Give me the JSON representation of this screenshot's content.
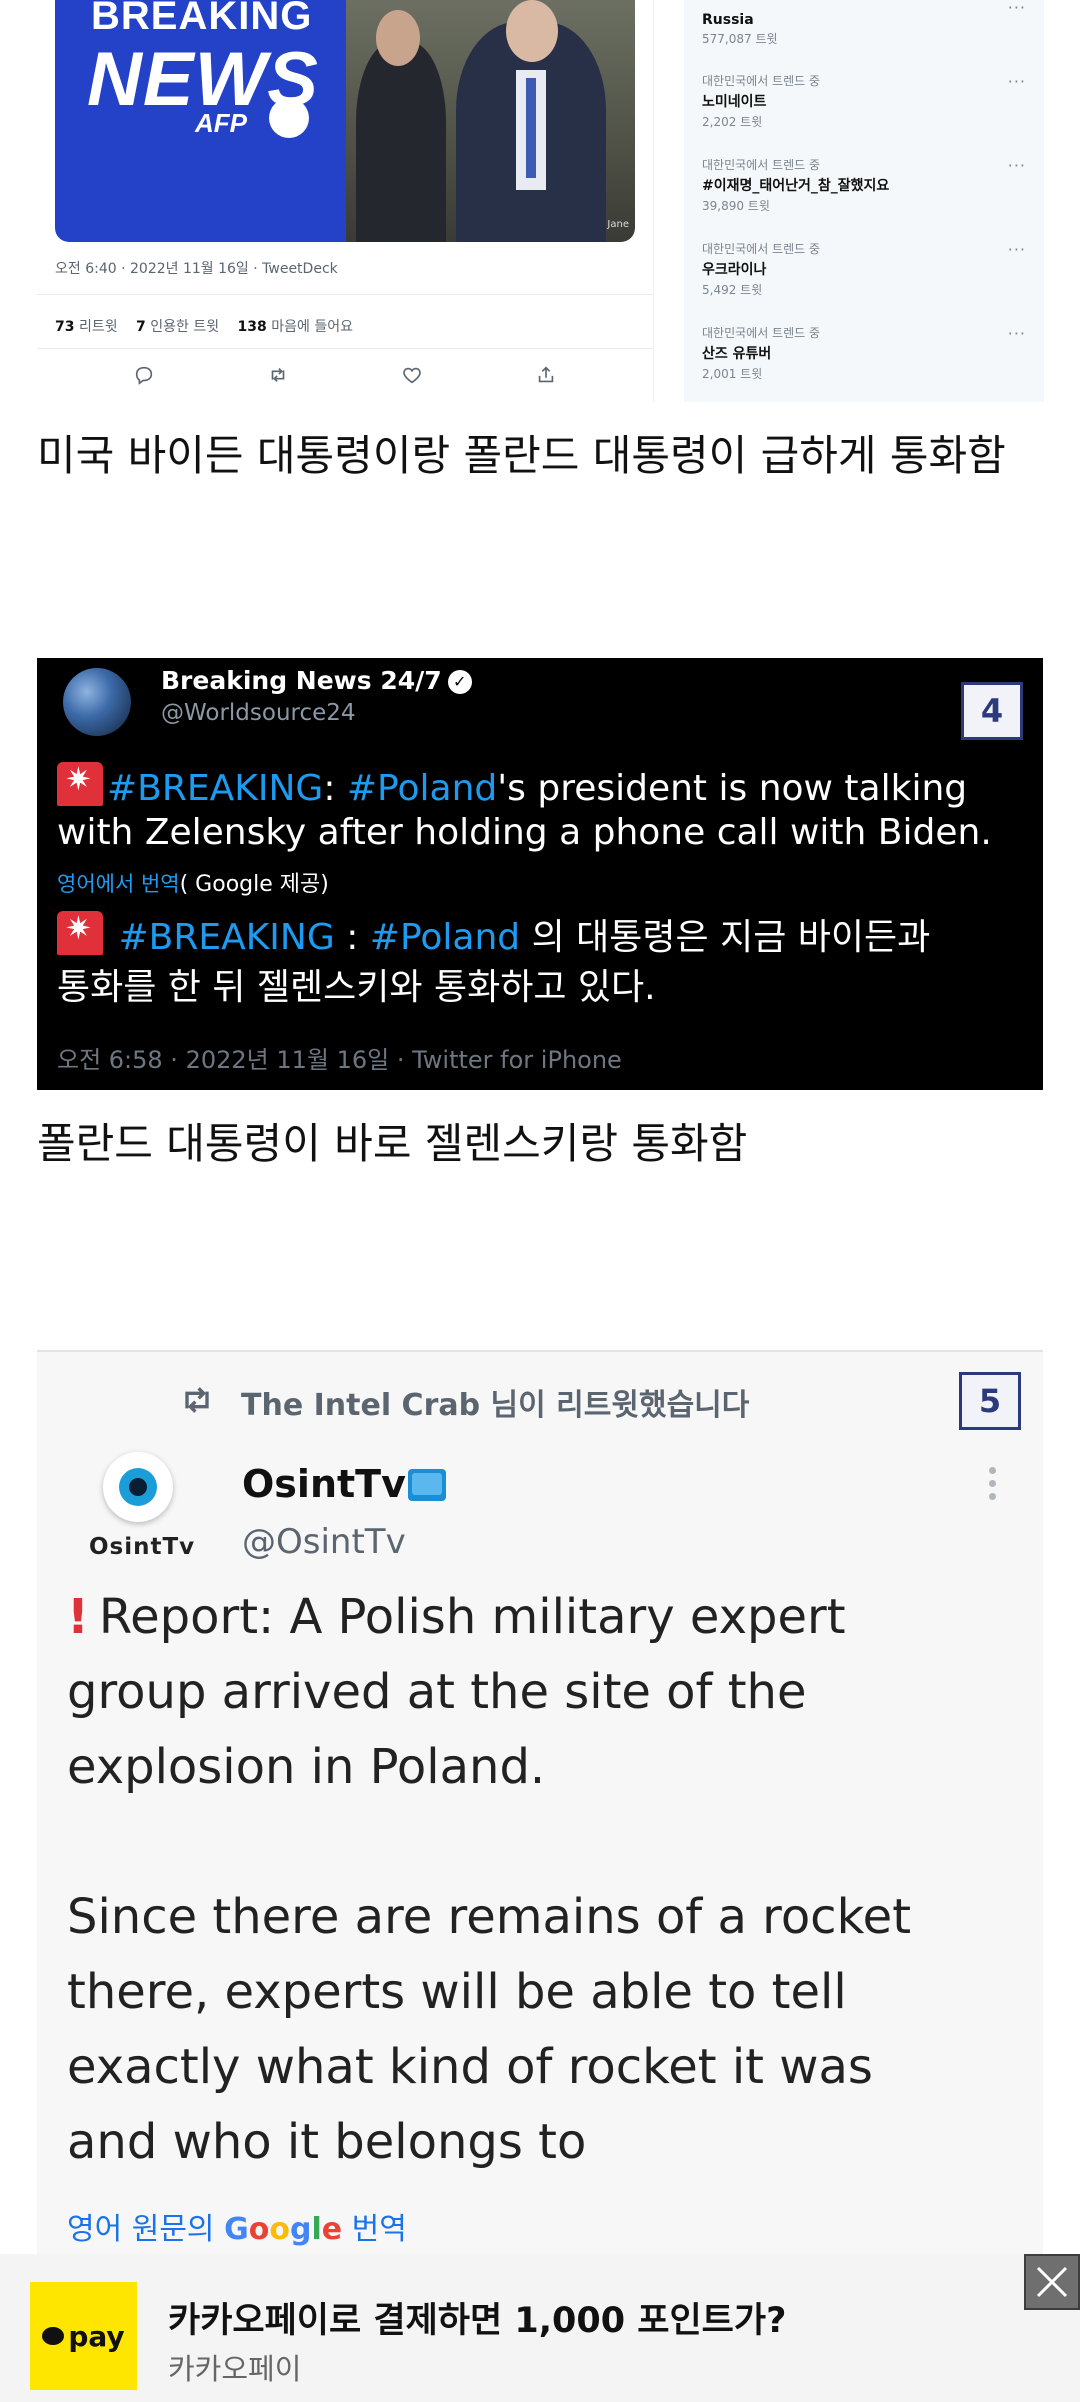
{
  "tweet1": {
    "image": {
      "line1": "BREAKING",
      "line2": "NEWS",
      "line3": "AFP",
      "photo_caption": "Jane"
    },
    "meta": "오전 6:40 · 2022년 11월 16일 · TweetDeck",
    "stats": [
      {
        "count": "73",
        "label": "리트윗"
      },
      {
        "count": "7",
        "label": "인용한 트윗"
      },
      {
        "count": "138",
        "label": "마음에 들어요"
      }
    ]
  },
  "trends": [
    {
      "context": "",
      "name": "Russia",
      "count": "577,087 트윗"
    },
    {
      "context": "대한민국에서 트렌드 중",
      "name": "노미네이트",
      "count": "2,202 트윗"
    },
    {
      "context": "대한민국에서 트렌드 중",
      "name": "#이재명_태어난거_참_잘했지요",
      "count": "39,890 트윗"
    },
    {
      "context": "대한민국에서 트렌드 중",
      "name": "우크라이나",
      "count": "5,492 트윗"
    },
    {
      "context": "대한민국에서 트렌드 중",
      "name": "산즈 유튜버",
      "count": "2,001 트윗"
    }
  ],
  "caption1": "미국 바이든 대통령이랑 폴란드 대통령이 급하게 통화함",
  "tweet2": {
    "badge": "4",
    "name": "Breaking News 24/7",
    "handle": "@Worldsource24",
    "en_tag1": "#BREAKING",
    "en_colon": ": ",
    "en_tag2": "#Poland",
    "en_rest1": "'s president is now talking",
    "en_line2": "with Zelensky after holding a phone call with Biden.",
    "translate_link": "영어에서 번역",
    "translate_by": "( Google 제공)",
    "ko_tag1": "#BREAKING",
    "ko_colon": " : ",
    "ko_tag2": "#Poland",
    "ko_rest1": " 의 대통령은 지금 바이든과",
    "ko_line2": "통화를 한 뒤 젤렌스키와 통화하고 있다.",
    "time": "오전 6:58 · 2022년 11월 16일 · Twitter for iPhone"
  },
  "caption2": "폴란드 대통령이 바로 젤렌스키랑 통화함",
  "tweet3": {
    "badge": "5",
    "retweet_text": "The Intel Crab 님이 리트윗했습니다",
    "avatar_label": "OsintTv",
    "name": "OsintTv",
    "handle": "@OsintTv",
    "body_line1": "Report: A Polish military expert",
    "body_line2": "group arrived at the site of the",
    "body_line3": "explosion in Poland.",
    "body_line5": "Since there are remains of a rocket",
    "body_line6": "there, experts will be able to tell",
    "body_line7": "exactly what kind of rocket it was",
    "body_line8": "and who it belongs to",
    "gtrans_pre": "영어 원문의 ",
    "gtrans_post": " 번역"
  },
  "ad": {
    "logo": "pay",
    "title": "카카오페이로 결제하면 1,000 포인트가?",
    "sub": "카카오페이"
  },
  "colors": {
    "accent": "#1d9bf0",
    "badge": "#2a3a7a",
    "kakao_yellow": "#ffe600"
  },
  "icons": [
    "reply-icon",
    "retweet-icon",
    "like-icon",
    "share-icon",
    "verified-icon",
    "siren-icon",
    "close-icon"
  ]
}
